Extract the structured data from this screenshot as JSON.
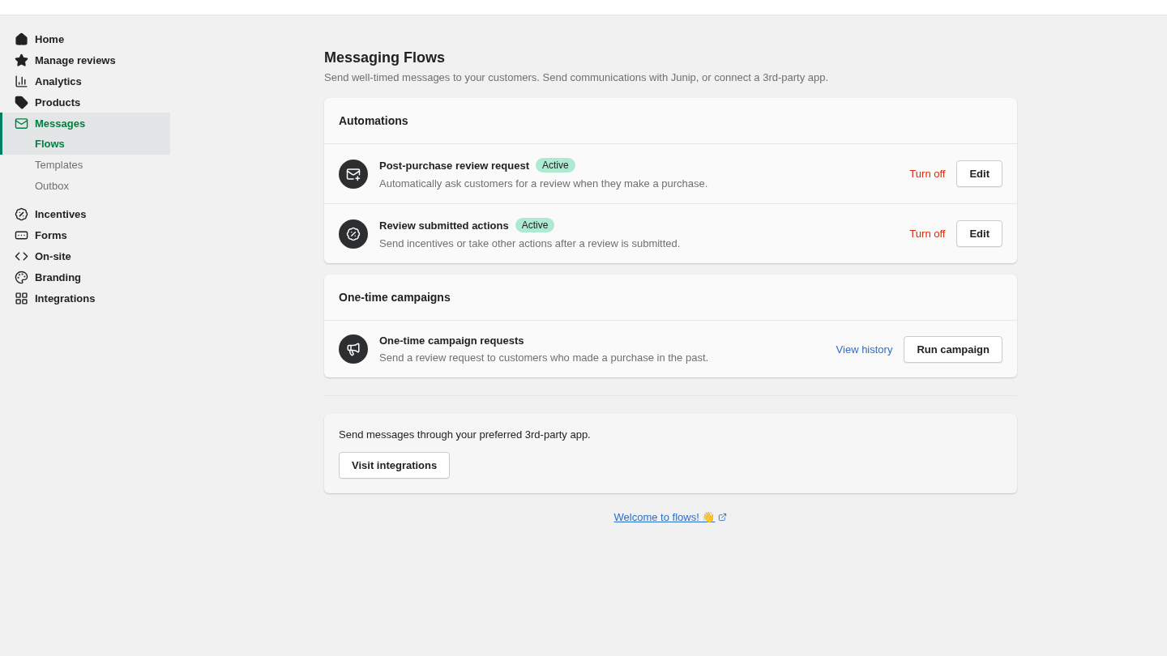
{
  "sidebar": {
    "items": [
      {
        "label": "Home",
        "selected": false
      },
      {
        "label": "Manage reviews",
        "selected": false
      },
      {
        "label": "Analytics",
        "selected": false
      },
      {
        "label": "Products",
        "selected": false
      },
      {
        "label": "Messages",
        "selected": true,
        "children": [
          {
            "label": "Flows",
            "selected": true
          },
          {
            "label": "Templates",
            "selected": false
          },
          {
            "label": "Outbox",
            "selected": false
          }
        ]
      },
      {
        "label": "Incentives",
        "selected": false
      },
      {
        "label": "Forms",
        "selected": false
      },
      {
        "label": "On-site",
        "selected": false
      },
      {
        "label": "Branding",
        "selected": false
      },
      {
        "label": "Integrations",
        "selected": false
      }
    ]
  },
  "page": {
    "title": "Messaging Flows",
    "subtitle": "Send well-timed messages to your customers. Send communications with Junip, or connect a 3rd-party app."
  },
  "sections": [
    {
      "title": "Automations",
      "rows": [
        {
          "title": "Post-purchase review request",
          "badge": "Active",
          "description": "Automatically ask customers for a review when they make a purchase.",
          "actions": [
            {
              "kind": "danger-link",
              "label": "Turn off"
            },
            {
              "kind": "button",
              "label": "Edit"
            }
          ]
        },
        {
          "title": "Review submitted actions",
          "badge": "Active",
          "description": "Send incentives or take other actions after a review is submitted.",
          "actions": [
            {
              "kind": "danger-link",
              "label": "Turn off"
            },
            {
              "kind": "button",
              "label": "Edit"
            }
          ]
        }
      ]
    },
    {
      "title": "One-time campaigns",
      "rows": [
        {
          "title": "One-time campaign requests",
          "description": "Send a review request to customers who made a purchase in the past.",
          "actions": [
            {
              "kind": "link",
              "label": "View history"
            },
            {
              "kind": "button",
              "label": "Run campaign"
            }
          ]
        }
      ]
    }
  ],
  "integrations_card": {
    "text": "Send messages through your preferred 3rd-party app.",
    "button": "Visit integrations"
  },
  "footer_link": "Welcome to flows! 👋"
}
